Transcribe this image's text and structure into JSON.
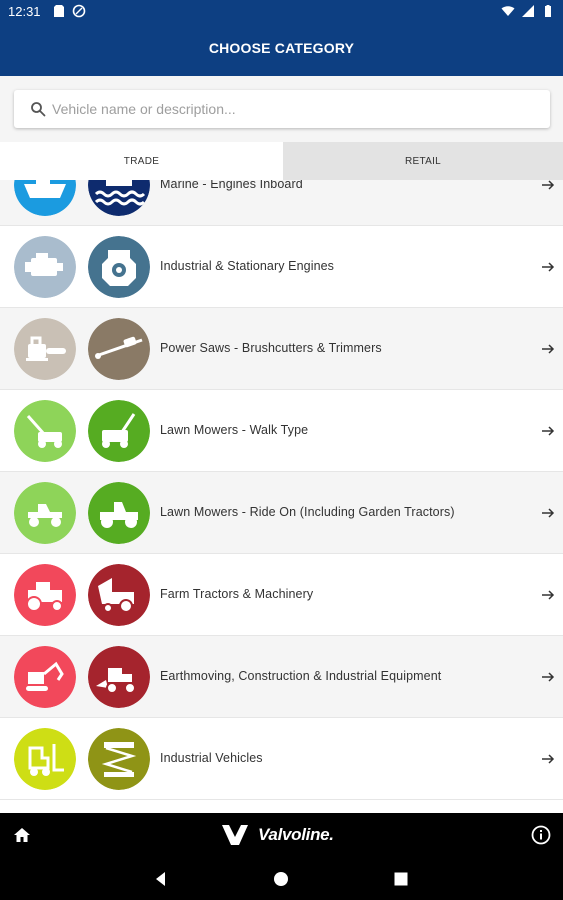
{
  "status_bar": {
    "time": "12:31",
    "left_icons": [
      "sd-card-icon",
      "data-saver-icon"
    ],
    "right_icons": [
      "wifi-icon",
      "signal-icon",
      "battery-icon"
    ]
  },
  "app_bar": {
    "title": "CHOOSE CATEGORY"
  },
  "search": {
    "placeholder": "Vehicle name or description..."
  },
  "tabs": [
    {
      "label": "TRADE",
      "selected": true
    },
    {
      "label": "RETAIL",
      "selected": false
    }
  ],
  "categories": [
    {
      "label": "Marine - Engines Inboard",
      "icons": [
        "boat-icon",
        "marine-engine-icon"
      ],
      "colors": [
        "#1b9be0",
        "#0e2b6e"
      ]
    },
    {
      "label": "Industrial & Stationary Engines",
      "icons": [
        "engine-icon",
        "stationary-engine-icon"
      ],
      "colors": [
        "#a9bccd",
        "#45738f"
      ]
    },
    {
      "label": "Power Saws - Brushcutters & Trimmers",
      "icons": [
        "chainsaw-icon",
        "brushcutter-icon"
      ],
      "colors": [
        "#c9c0b5",
        "#8a7a66"
      ]
    },
    {
      "label": "Lawn Mowers - Walk Type",
      "icons": [
        "walk-mower-icon",
        "walk-mower-icon"
      ],
      "colors": [
        "#8ed459",
        "#56ac22"
      ]
    },
    {
      "label": "Lawn Mowers - Ride On (Including Garden Tractors)",
      "icons": [
        "ride-on-mower-icon",
        "garden-tractor-icon"
      ],
      "colors": [
        "#8ed459",
        "#56ac22"
      ]
    },
    {
      "label": "Farm Tractors & Machinery",
      "icons": [
        "tractor-icon",
        "harvester-icon"
      ],
      "colors": [
        "#f2485b",
        "#a5242d"
      ]
    },
    {
      "label": "Earthmoving, Construction & Industrial Equipment",
      "icons": [
        "excavator-icon",
        "wheel-loader-icon"
      ],
      "colors": [
        "#f2485b",
        "#a5242d"
      ]
    },
    {
      "label": "Industrial Vehicles",
      "icons": [
        "forklift-icon",
        "scissor-lift-icon"
      ],
      "colors": [
        "#cede15",
        "#8f9416"
      ]
    }
  ],
  "bottom_bar": {
    "brand": "Valvoline."
  },
  "nav_bar": {
    "icons": [
      "back-icon",
      "home-circle-icon",
      "recents-icon"
    ]
  }
}
